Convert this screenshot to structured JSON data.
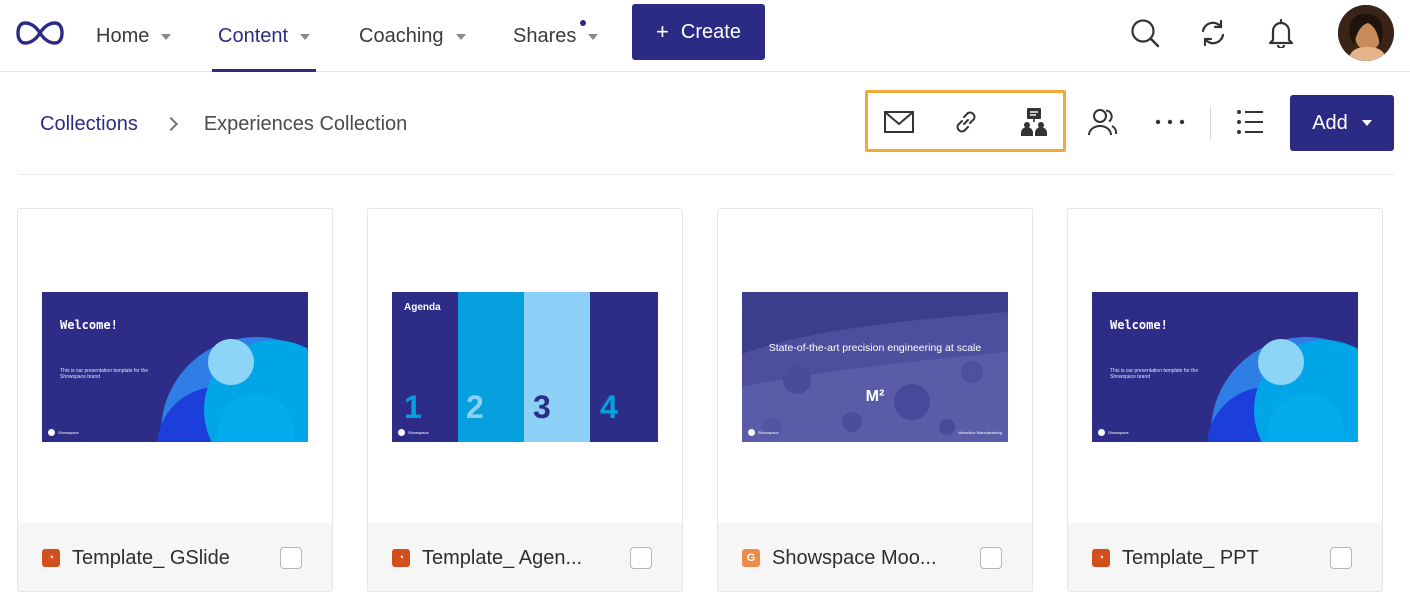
{
  "nav": {
    "items": [
      {
        "label": "Home"
      },
      {
        "label": "Content"
      },
      {
        "label": "Coaching"
      },
      {
        "label": "Shares"
      }
    ],
    "create_label": "Create"
  },
  "breadcrumb": {
    "parent": "Collections",
    "current": "Experiences Collection"
  },
  "toolbar": {
    "add_label": "Add",
    "highlight_color": "#f2a93b"
  },
  "colors": {
    "brand": "#2b2b86",
    "gslides_icon": "#ee8a4a",
    "ppt_icon": "#d24f1c"
  },
  "cards": [
    {
      "title": "Template_ GSlide",
      "file_type": "ppt-icon",
      "slide": {
        "heading": "Welcome!",
        "body": "This is our presentation template for the Showspace brand",
        "brand": "Showspace"
      }
    },
    {
      "title": "Template_ Agen...",
      "file_type": "ppt-icon",
      "slide": {
        "heading": "Agenda",
        "numbers": [
          "1",
          "2",
          "3",
          "4"
        ],
        "brand": "Showspace"
      }
    },
    {
      "title": "Showspace Moo...",
      "file_type": "gslides-icon",
      "slide": {
        "heading": "State-of-the-art precision engineering at scale",
        "mark": "M²",
        "brand": "Showspace",
        "footer": "Monobloc Manufacturing"
      }
    },
    {
      "title": "Template_ PPT",
      "file_type": "ppt-icon",
      "slide": {
        "heading": "Welcome!",
        "body": "This is our presentation template for the Showspace brand",
        "brand": "Showspace"
      }
    }
  ]
}
